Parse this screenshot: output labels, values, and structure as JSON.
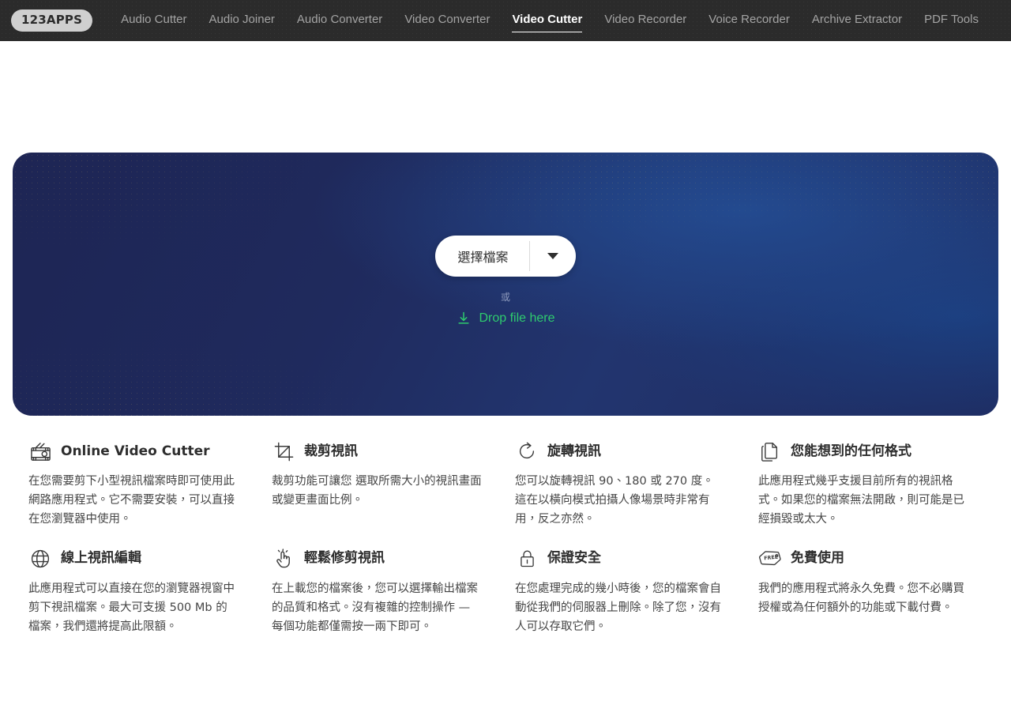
{
  "header": {
    "logo": "123APPS",
    "nav": [
      {
        "label": "Audio Cutter",
        "active": false
      },
      {
        "label": "Audio Joiner",
        "active": false
      },
      {
        "label": "Audio Converter",
        "active": false
      },
      {
        "label": "Video Converter",
        "active": false
      },
      {
        "label": "Video Cutter",
        "active": true
      },
      {
        "label": "Video Recorder",
        "active": false
      },
      {
        "label": "Voice Recorder",
        "active": false
      },
      {
        "label": "Archive Extractor",
        "active": false
      },
      {
        "label": "PDF Tools",
        "active": false
      }
    ]
  },
  "hero": {
    "choose_file_label": "選擇檔案",
    "dropdown_icon": "chevron-down-icon",
    "or_label": "或",
    "drop_icon": "download-arrow-icon",
    "drop_label": "Drop file here",
    "colors": {
      "gradient_dark": "#1e2554",
      "gradient_bright": "#234a8f",
      "drop_text": "#2ecb6e",
      "or_text": "#8f9bbd"
    }
  },
  "features": [
    {
      "icon": "film-clapper-icon",
      "title": "Online Video Cutter",
      "body": "在您需要剪下小型視訊檔案時即可使用此網路應用程式。它不需要安裝，可以直接在您瀏覽器中使用。"
    },
    {
      "icon": "crop-icon",
      "title": "裁剪視訊",
      "body": "裁剪功能可讓您 選取所需大小的視訊畫面或變更畫面比例。"
    },
    {
      "icon": "rotate-icon",
      "title": "旋轉視訊",
      "body": "您可以旋轉視訊 90、180 或 270 度。這在以橫向模式拍攝人像場景時非常有用，反之亦然。"
    },
    {
      "icon": "copy-documents-icon",
      "title": "您能想到的任何格式",
      "body": "此應用程式幾乎支援目前所有的視訊格式。如果您的檔案無法開啟，則可能是已經損毀或太大。"
    },
    {
      "icon": "globe-icon",
      "title": "線上視訊編輯",
      "body": "此應用程式可以直接在您的瀏覽器視窗中剪下視訊檔案。最大可支援 500 Mb 的檔案，我們還將提高此限額。"
    },
    {
      "icon": "click-hand-icon",
      "title": "輕鬆修剪視訊",
      "body": "在上載您的檔案後，您可以選擇輸出檔案的品質和格式。沒有複雜的控制操作 — 每個功能都僅需按一兩下即可。"
    },
    {
      "icon": "lock-icon",
      "title": "保證安全",
      "body": "在您處理完成的幾小時後，您的檔案會自動從我們的伺服器上刪除。除了您，沒有人可以存取它們。"
    },
    {
      "icon": "price-tag-free-icon",
      "title": "免費使用",
      "body": "我們的應用程式將永久免費。您不必購買授權或為任何額外的功能或下載付費。"
    }
  ]
}
